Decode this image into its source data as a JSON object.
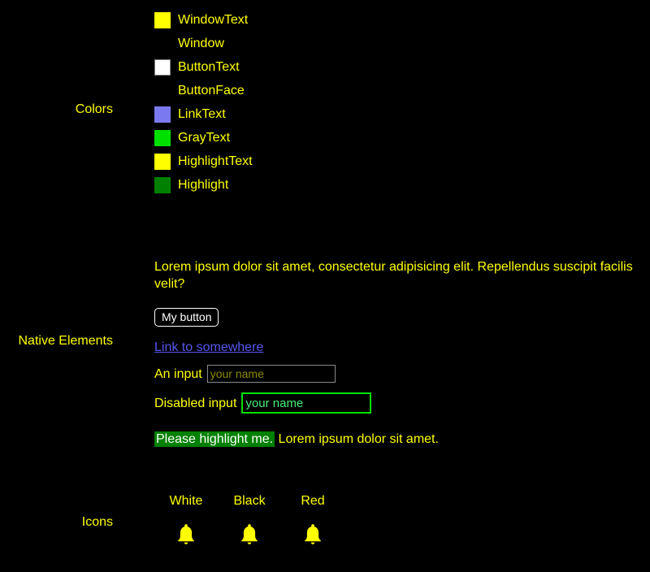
{
  "page": {
    "background": "#000000",
    "text_color": "#ffff00"
  },
  "colors": {
    "label": "Colors",
    "items": [
      {
        "name": "WindowText",
        "swatch": "#ffff00",
        "bordered": false,
        "icon": "color-swatch"
      },
      {
        "name": "Window",
        "swatch": "#000000",
        "bordered": false,
        "icon": "color-swatch"
      },
      {
        "name": "ButtonText",
        "swatch": "#ffffff",
        "bordered": true,
        "icon": "color-swatch"
      },
      {
        "name": "ButtonFace",
        "swatch": "#000000",
        "bordered": false,
        "icon": "color-swatch"
      },
      {
        "name": "LinkText",
        "swatch": "#7a7aee",
        "bordered": false,
        "icon": "color-swatch"
      },
      {
        "name": "GrayText",
        "swatch": "#00e000",
        "bordered": false,
        "icon": "color-swatch"
      },
      {
        "name": "HighlightText",
        "swatch": "#ffff00",
        "bordered": false,
        "icon": "color-swatch"
      },
      {
        "name": "Highlight",
        "swatch": "#008000",
        "bordered": false,
        "icon": "color-swatch"
      }
    ]
  },
  "native": {
    "label": "Native Elements",
    "paragraph": "Lorem ipsum dolor sit amet, consectetur adipisicing elit. Repellendus suscipit facilis velit?",
    "button_label": "My button",
    "link_label": "Link to somewhere",
    "link_color": "#5555ee",
    "input": {
      "label": "An input",
      "value": "",
      "placeholder": "your name",
      "border_color": "#8a8a8a",
      "placeholder_color": "#8a8a00"
    },
    "disabled_input": {
      "label": "Disabled input",
      "value": "",
      "placeholder": "your name",
      "border_color": "#00e000",
      "placeholder_color": "#44ee77"
    },
    "highlight": {
      "highlighted_text": "Please highlight me.",
      "trailing_text": " Lorem ipsum dolor sit amet.",
      "background": "#008000",
      "color": "#ffffff"
    }
  },
  "icons": {
    "label": "Icons",
    "columns": [
      {
        "title": "White",
        "icon": "bell-icon",
        "rendered_color": "#ffff00"
      },
      {
        "title": "Black",
        "icon": "bell-icon",
        "rendered_color": "#ffff00"
      },
      {
        "title": "Red",
        "icon": "bell-icon",
        "rendered_color": "#ffff00"
      }
    ]
  }
}
